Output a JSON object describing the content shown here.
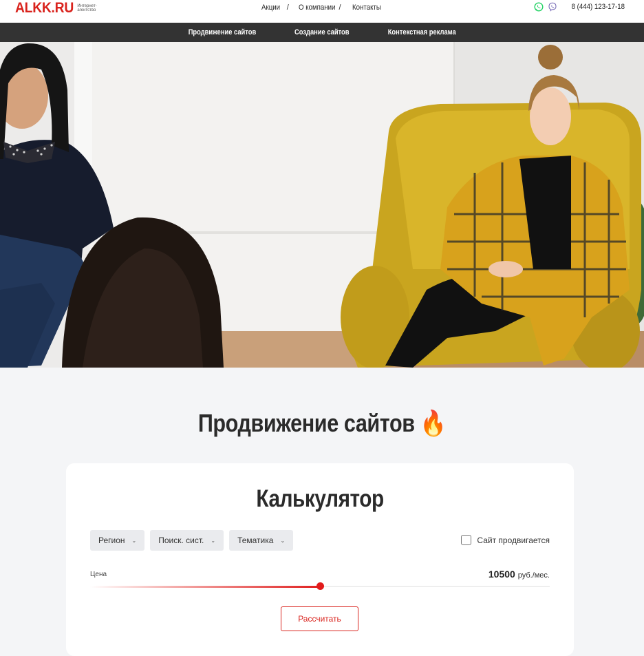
{
  "header": {
    "logo": "ALKK.RU",
    "logo_sub": "Интернет-агентство",
    "nav": [
      "Акции",
      "О компании",
      "Контакты"
    ],
    "nav_separator": "/",
    "phone": "8 (444) 123-17-18",
    "icons": [
      "whatsapp-icon",
      "viber-icon"
    ]
  },
  "menu": {
    "items": [
      "Продвижение сайтов",
      "Создание сайтов",
      "Контекстная реклама"
    ]
  },
  "page": {
    "title": "Продвижение сайтов",
    "title_emoji": "🔥"
  },
  "calculator": {
    "title": "Калькулятор",
    "filters": [
      "Регион",
      "Поиск. сист.",
      "Тематика"
    ],
    "checkbox_label": "Сайт продвигается",
    "checkbox_checked": false,
    "price_label": "Цена",
    "price_value": "10500",
    "price_unit": "руб./мес.",
    "slider_fraction": 0.5,
    "button_label": "Рассчитать"
  },
  "colors": {
    "brand_red": "#d9231d",
    "menu_bg": "#333333",
    "page_bg": "#f4f5f7",
    "whatsapp": "#25d366",
    "viber": "#7b6fb8"
  }
}
